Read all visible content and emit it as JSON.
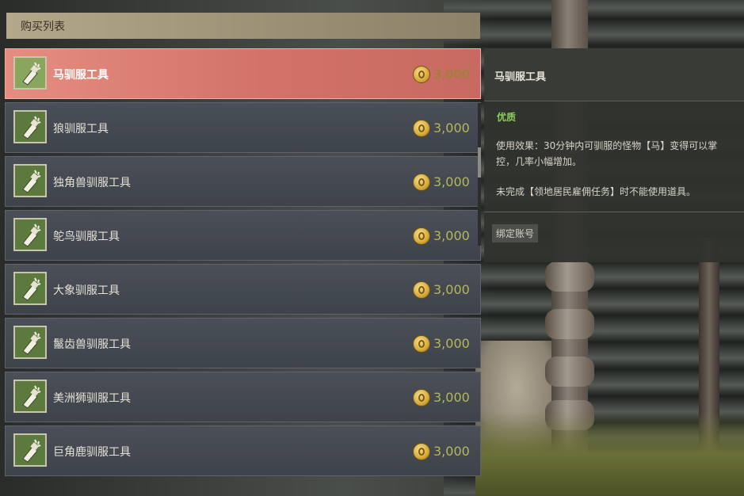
{
  "shop": {
    "header": "购买列表",
    "currency_icon": "gold-coin-icon",
    "items": [
      {
        "name": "马驯服工具",
        "price": "3,000",
        "selected": true
      },
      {
        "name": "狼驯服工具",
        "price": "3,000",
        "selected": false
      },
      {
        "name": "独角兽驯服工具",
        "price": "3,000",
        "selected": false
      },
      {
        "name": "鸵鸟驯服工具",
        "price": "3,000",
        "selected": false
      },
      {
        "name": "大象驯服工具",
        "price": "3,000",
        "selected": false
      },
      {
        "name": "鬣齿兽驯服工具",
        "price": "3,000",
        "selected": false
      },
      {
        "name": "美洲狮驯服工具",
        "price": "3,000",
        "selected": false
      },
      {
        "name": "巨角鹿驯服工具",
        "price": "3,000",
        "selected": false
      }
    ]
  },
  "detail": {
    "title": "马驯服工具",
    "quality": "优质",
    "effect": "使用效果：30分钟内可驯服的怪物【马】变得可以掌控，几率小幅增加。",
    "condition": "未完成【领地居民雇佣任务】时不能使用道具。",
    "bind_tag": "绑定账号"
  },
  "colors": {
    "selected_row": "#d27268",
    "row": "#434850",
    "price": "#b6b65a",
    "quality": "#8dcf5b",
    "header": "#a89d80"
  }
}
